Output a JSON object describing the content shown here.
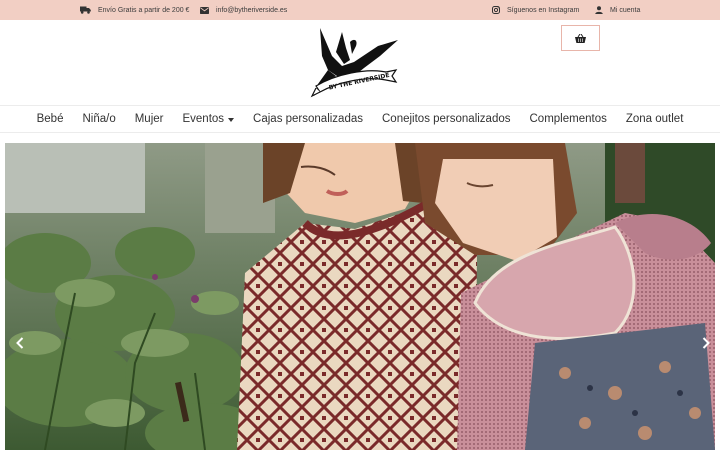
{
  "topbar": {
    "shipping_text": "Envío Gratis a partir de 200 €",
    "email_text": "info@bytheriverside.es",
    "instagram_text": "Síguenos en Instagram",
    "account_text": "Mi cuenta"
  },
  "logo": {
    "banner_text": "BY THE RIVERSIDE"
  },
  "nav": {
    "items": [
      {
        "label": "Bebé"
      },
      {
        "label": "Niña/o"
      },
      {
        "label": "Mujer"
      },
      {
        "label": "Eventos"
      },
      {
        "label": "Cajas personalizadas"
      },
      {
        "label": "Conejitos personalizados"
      },
      {
        "label": "Complementos"
      },
      {
        "label": "Zona outlet"
      }
    ]
  },
  "colors": {
    "topbar_bg": "#f2cfc4",
    "cart_border": "#e8b5aa",
    "text": "#333333"
  },
  "icons": {
    "shipping": "truck-icon",
    "email": "envelope-icon",
    "instagram": "instagram-icon",
    "account": "user-icon",
    "cart": "basket-icon",
    "slider_prev": "chevron-left-icon",
    "slider_next": "chevron-right-icon"
  }
}
